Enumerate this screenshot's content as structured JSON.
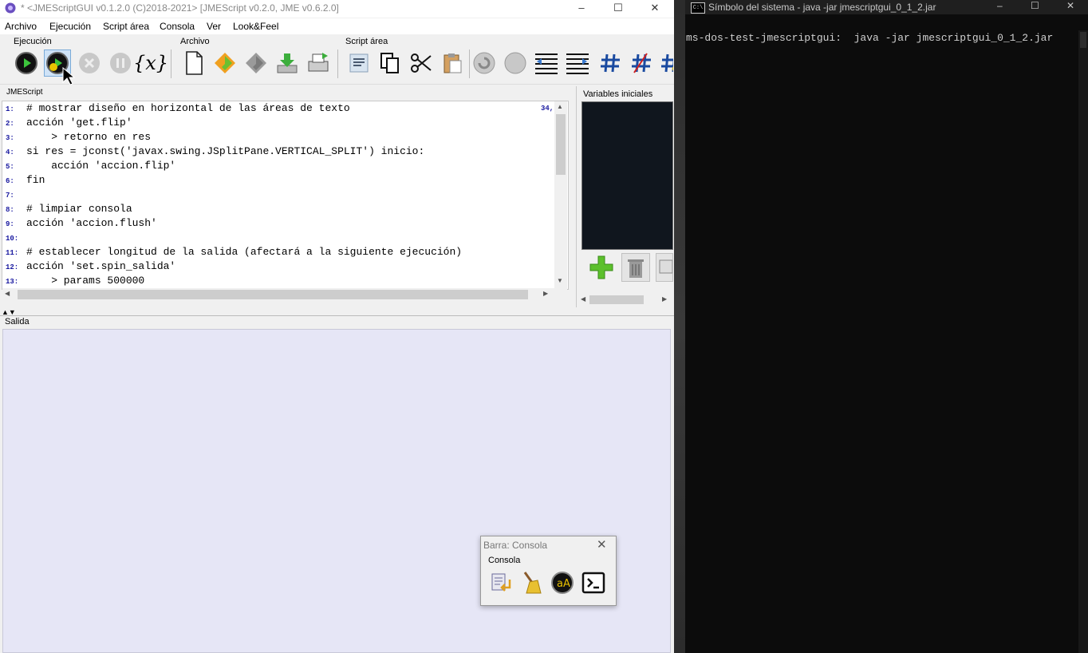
{
  "window": {
    "title": "* <JMEScriptGUI v0.1.2.0  (C)2018-2021>   [JMEScript v0.2.0, JME v0.6.2.0]",
    "min": "–",
    "max": "☐",
    "close": "✕"
  },
  "menu": [
    "Archivo",
    "Ejecución",
    "Script área",
    "Consola",
    "Ver",
    "Look&Feel"
  ],
  "toolbar_groups": {
    "ejecucion": "Ejecución",
    "archivo": "Archivo",
    "script_area": "Script área"
  },
  "icons": {
    "run": "run-icon",
    "run_step": "run-step-icon",
    "stop": "stop-icon",
    "pause": "pause-icon",
    "variables": "x-variable-icon",
    "x_label": "{x}",
    "new": "new-file-icon",
    "open": "open-icon",
    "save": "save-icon",
    "download": "download-icon",
    "print": "print-icon",
    "list": "list-icon",
    "copy": "copy-icon",
    "cut": "cut-icon",
    "paste": "paste-icon",
    "undo": "undo-icon",
    "redo": "redo-icon",
    "indent_left": "indent-left-icon",
    "indent_right": "indent-right-icon",
    "comment": "hash-icon",
    "uncomment": "hash-remove-icon"
  },
  "editor": {
    "label": "JMEScript",
    "position": "34,",
    "lines": [
      {
        "n": "1:",
        "text": "# mostrar diseño en horizontal de las áreas de texto"
      },
      {
        "n": "2:",
        "text": "acción 'get.flip'"
      },
      {
        "n": "3:",
        "text": "    > retorno en res"
      },
      {
        "n": "4:",
        "text": "si res = jconst('javax.swing.JSplitPane.VERTICAL_SPLIT') inicio:"
      },
      {
        "n": "5:",
        "text": "    acción 'accion.flip'"
      },
      {
        "n": "6:",
        "text": "fin"
      },
      {
        "n": "7:",
        "text": ""
      },
      {
        "n": "8:",
        "text": "# limpiar consola"
      },
      {
        "n": "9:",
        "text": "acción 'accion.flush'"
      },
      {
        "n": "10:",
        "text": ""
      },
      {
        "n": "11:",
        "text": "# establecer longitud de la salida (afectará a la siguiente ejecución)"
      },
      {
        "n": "12:",
        "text": "acción 'set.spin_salida'"
      },
      {
        "n": "13:",
        "text": "    > params 500000"
      }
    ]
  },
  "variables": {
    "label": "Variables iniciales",
    "add": "add-variable-icon",
    "delete": "trash-icon",
    "edit": "edit-icon"
  },
  "output": {
    "label": "Salida"
  },
  "floating_bar": {
    "title": "Barra: Consola",
    "close": "✕",
    "group": "Consola",
    "icons": [
      "insert-icon",
      "broom-icon",
      "font-icon",
      "terminal-icon"
    ]
  },
  "console": {
    "title": "Símbolo del sistema - java  -jar jmescriptgui_0_1_2.jar",
    "icon_label": "C:\\",
    "min": "–",
    "max": "☐",
    "close": "✕",
    "line": "ms-dos-test-jmescriptgui:  java -jar jmescriptgui_0_1_2.jar"
  }
}
